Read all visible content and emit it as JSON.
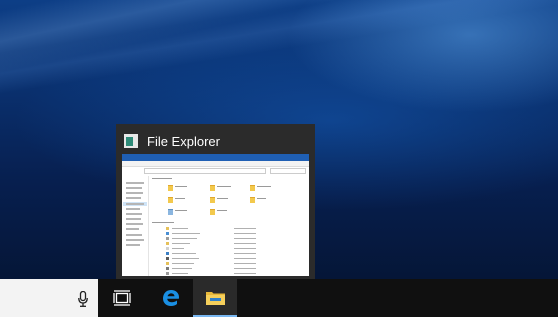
{
  "preview": {
    "title": "File Explorer",
    "icon": "file-explorer-icon"
  },
  "taskbar": {
    "search_icon": "microphone-icon",
    "task_view_icon": "task-view-icon",
    "edge_icon": "edge-icon",
    "explorer_icon": "file-explorer-folder-icon",
    "accent_color": "#79b7f1"
  },
  "colors": {
    "taskbar": "#101010",
    "preview_bg": "#2b2b2b",
    "search_box": "#f3f3f3"
  }
}
